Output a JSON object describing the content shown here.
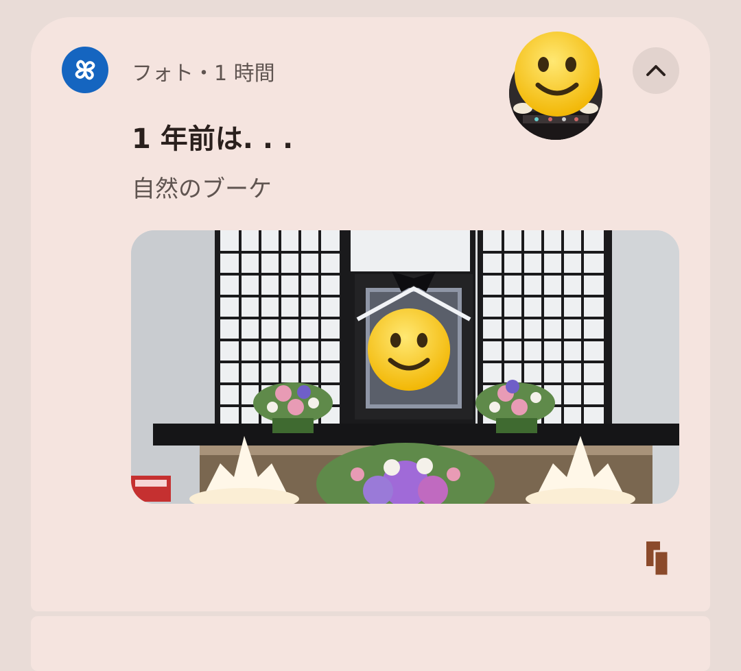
{
  "notification": {
    "app_name": "フォト",
    "separator": "・",
    "time": "1 時間",
    "title": "1 年前は. . .",
    "subtitle": "自然のブーケ"
  },
  "icons": {
    "app": "pinwheel-icon",
    "expand": "chevron-up-icon",
    "action": "view-copy-icon"
  },
  "colors": {
    "card_background": "#f5e4df",
    "app_icon": "#1565c0",
    "action_icon": "#8b4a2b"
  }
}
